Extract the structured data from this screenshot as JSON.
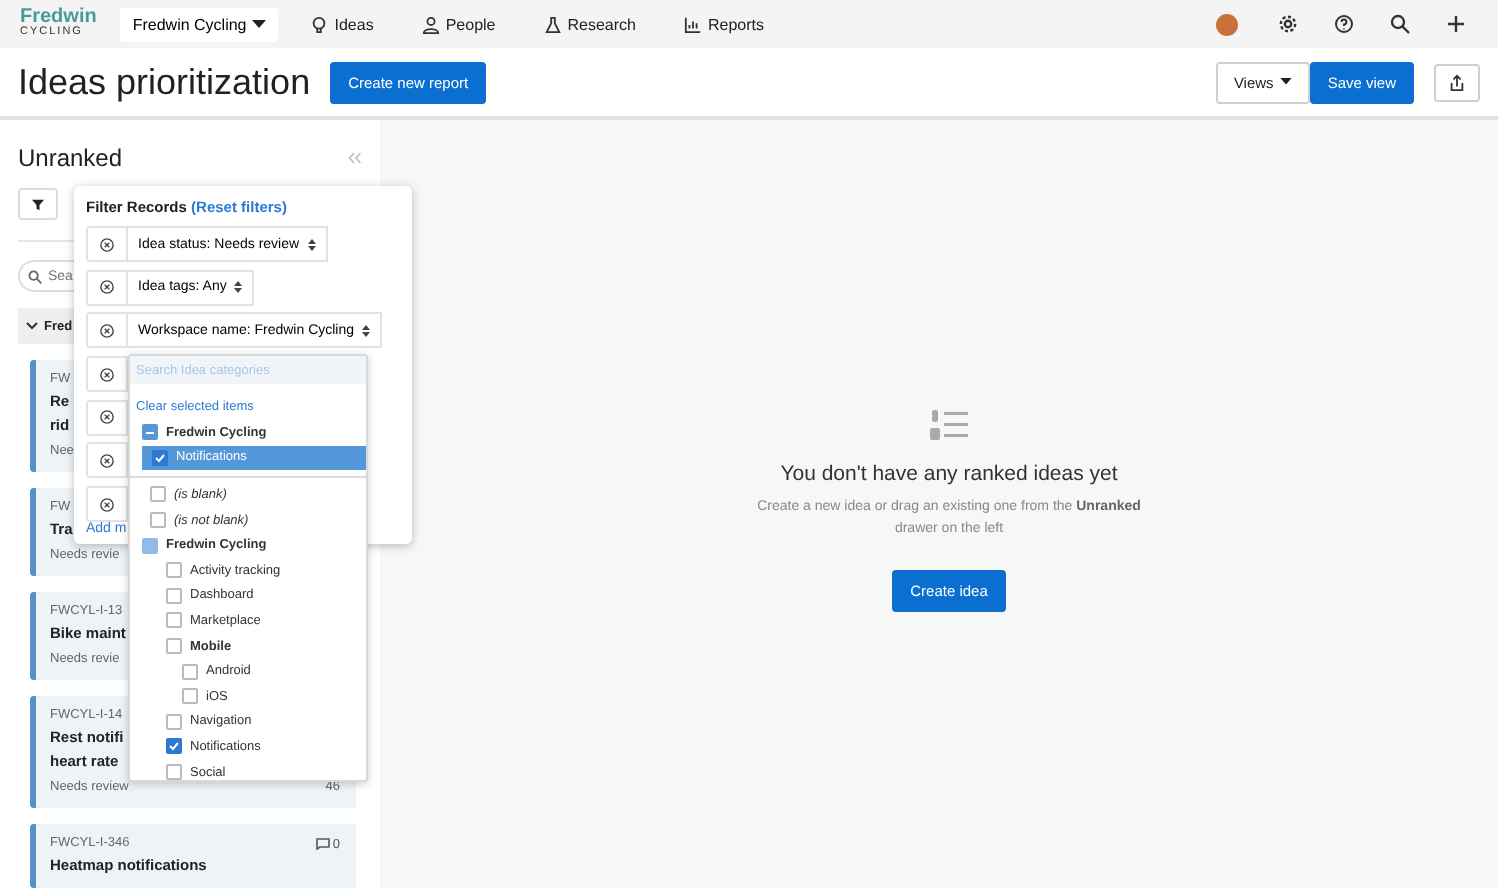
{
  "nav": {
    "logo_top": "Fredwin",
    "logo_bottom": "CYCLING",
    "workspace": "Fredwin Cycling",
    "items": [
      {
        "label": "Ideas"
      },
      {
        "label": "People"
      },
      {
        "label": "Research"
      },
      {
        "label": "Reports"
      }
    ]
  },
  "header": {
    "title": "Ideas prioritization",
    "create_button": "Create new report",
    "views_button": "Views",
    "save_button": "Save view"
  },
  "drawer": {
    "title": "Unranked",
    "search_placeholder": "Sea",
    "group": "Fred",
    "cards": [
      {
        "id": "FW",
        "title_lines": [
          "Re",
          "rid"
        ],
        "status": "Nee"
      },
      {
        "id": "FW",
        "title_lines": [
          "Tra"
        ],
        "status": "Needs revie"
      },
      {
        "id": "FWCYL-I-13",
        "title_lines": [
          "Bike maint"
        ],
        "status": "Needs revie"
      },
      {
        "id": "FWCYL-I-14",
        "title_lines": [
          "Rest notifi",
          "heart rate"
        ],
        "status": "Needs review",
        "count": "46"
      },
      {
        "id": "FWCYL-I-346",
        "comments": "0",
        "title_lines": [
          "Heatmap notifications"
        ]
      }
    ]
  },
  "filter": {
    "title": "Filter Records",
    "reset": "(Reset filters)",
    "add_link": "Add m",
    "rows": [
      {
        "label": "Idea status: Needs review"
      },
      {
        "label": "Idea tags: Any"
      },
      {
        "label": "Workspace name: Fredwin Cycling"
      },
      {},
      {},
      {},
      {}
    ]
  },
  "dropdown": {
    "search_placeholder": "Search Idea categories",
    "clear": "Clear selected items",
    "selected": [
      {
        "label": "Fredwin Cycling",
        "kind": "group",
        "partial": true,
        "children": [
          {
            "label": "Notifications",
            "kind": "option",
            "checked": true,
            "highlighted": true
          }
        ]
      }
    ],
    "options": [
      {
        "label": "(is blank)",
        "kind": "special",
        "checked": false
      },
      {
        "label": "(is not blank)",
        "kind": "special",
        "checked": false
      },
      {
        "label": "Fredwin Cycling",
        "kind": "group",
        "partial": false,
        "children": [
          {
            "label": "Activity tracking",
            "kind": "option",
            "checked": false
          },
          {
            "label": "Dashboard",
            "kind": "option",
            "checked": false
          },
          {
            "label": "Marketplace",
            "kind": "option",
            "checked": false
          },
          {
            "label": "Mobile",
            "kind": "parent",
            "checked": false,
            "children": [
              {
                "label": "Android",
                "kind": "option",
                "checked": false
              },
              {
                "label": "iOS",
                "kind": "option",
                "checked": false
              }
            ]
          },
          {
            "label": "Navigation",
            "kind": "option",
            "checked": false
          },
          {
            "label": "Notifications",
            "kind": "option",
            "checked": true
          },
          {
            "label": "Social",
            "kind": "option",
            "checked": false
          }
        ]
      }
    ]
  },
  "empty": {
    "title": "You don't have any ranked ideas yet",
    "text": "Create a new idea or drag an existing one from the **Unranked** drawer on the left",
    "button": "Create idea"
  }
}
